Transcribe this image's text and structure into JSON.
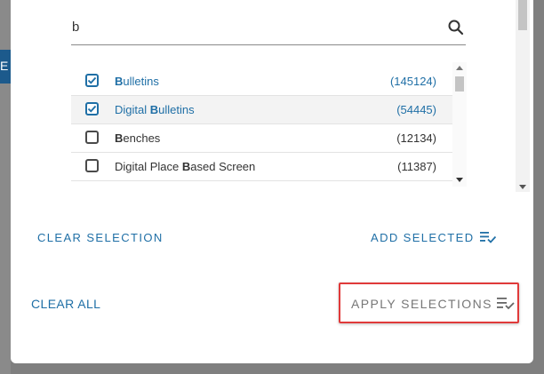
{
  "backdrop": {
    "button_fragment": "E"
  },
  "search": {
    "value": "b",
    "placeholder": ""
  },
  "items": [
    {
      "prefix": "",
      "match": "B",
      "rest": "ulletins",
      "count": "(145124)",
      "checked": true
    },
    {
      "prefix": "Digital ",
      "match": "B",
      "rest": "ulletins",
      "count": "(54445)",
      "checked": true
    },
    {
      "prefix": "",
      "match": "B",
      "rest": "enches",
      "count": "(12134)",
      "checked": false
    },
    {
      "prefix": "Digital Place ",
      "match": "B",
      "rest": "ased Screen",
      "count": "(11387)",
      "checked": false
    }
  ],
  "actions": {
    "clear_selection": "CLEAR SELECTION",
    "add_selected": "ADD SELECTED",
    "clear_all": "CLEAR ALL",
    "apply_selections": "APPLY SELECTIONS"
  },
  "colors": {
    "accent": "#1f6fa6",
    "highlight_border": "#e03a3a"
  },
  "icons": {
    "search": "search-icon",
    "add_selected": "playlist-check-icon",
    "apply": "playlist-check-icon"
  }
}
